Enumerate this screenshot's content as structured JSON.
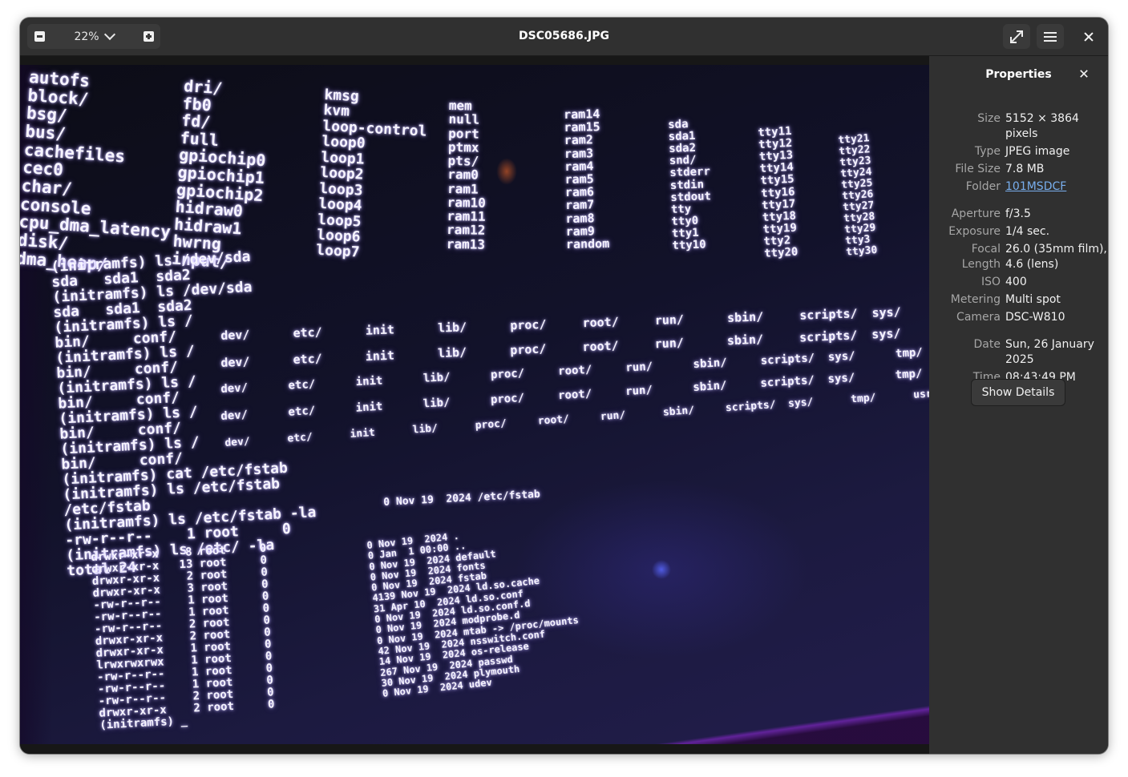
{
  "window": {
    "title": "DSC05686.JPG"
  },
  "toolbar": {
    "zoom_level": "22%",
    "zoom_out_icon": "zoom-out-icon",
    "zoom_in_icon": "zoom-in-icon",
    "fullscreen_icon": "fullscreen-icon",
    "menu_icon": "hamburger-menu-icon",
    "close_icon": "close-icon"
  },
  "sidebar": {
    "title": "Properties",
    "properties": [
      {
        "label": "Size",
        "value": "5152 × 3864 pixels"
      },
      {
        "label": "Type",
        "value": "JPEG image"
      },
      {
        "label": "File Size",
        "value": "7.8 MB"
      },
      {
        "label": "Folder",
        "value": "101MSDCF"
      },
      {
        "label": "Aperture",
        "value": "f/3.5"
      },
      {
        "label": "Exposure",
        "value": "1/4 sec."
      },
      {
        "label": "Focal Length",
        "value": "26.0 (35mm film), 4.6 (lens)"
      },
      {
        "label": "ISO",
        "value": "400"
      },
      {
        "label": "Metering",
        "value": "Multi spot"
      },
      {
        "label": "Camera",
        "value": "DSC-W810"
      },
      {
        "label": "Date",
        "value": "Sun, 26 January 2025"
      },
      {
        "label": "Time",
        "value": "08:43:49 PM"
      }
    ],
    "details_button": "Show Details"
  },
  "photo": {
    "col_a": "autofs\nblock/\nbsg/\nbus/\ncachefiles\ncec0\nchar/\nconsole\ncpu_dma_latency\ndisk/\ndma_heap/",
    "col_b": "dri/\nfb0\nfd/\nfull\ngpiochip0\ngpiochip1\ngpiochip2\nhidraw0\nhidraw1\nhwrng\ninput/",
    "col_c": "kmsg\nkvm\nloop-control\nloop0\nloop1\nloop2\nloop3\nloop4\nloop5\nloop6\nloop7",
    "col_d": "mem\nnull\nport\nptmx\npts/\nram0\nram1\nram10\nram11\nram12\nram13",
    "col_e": "ram14\nram15\nram2\nram3\nram4\nram5\nram6\nram7\nram8\nram9\nrandom",
    "col_f": "sda\nsda1\nsda2\nsnd/\nstderr\nstdin\nstdout\ntty\ntty0\ntty1\ntty10",
    "col_g": "tty11\ntty12\ntty13\ntty14\ntty15\ntty16\ntty17\ntty18\ntty19\ntty2\ntty20",
    "col_h": "tty21\ntty22\ntty23\ntty24\ntty25\ntty26\ntty27\ntty28\ntty29\ntty3\ntty30",
    "session_1": "(initramfs) ls /dev/sda\nsda   sda1  sda2\n(initramfs) ls /dev/sda\nsda   sda1  sda2\n(initramfs) ls /\nbin/     conf/\n(initramfs) ls /\nbin/     conf/\n(initramfs) ls /\nbin/     conf/\n(initramfs) ls /\nbin/     conf/\n(initramfs) ls /\nbin/     conf/\n(initramfs) cat /etc/fstab\n(initramfs) ls /etc/fstab\n/etc/fstab\n(initramfs) ls /etc/fstab -la\n-rw-r--r--    1 root     0\n(initramfs) ls /etc/ -la\ntotal 24",
    "root_row": "dev/      etc/      init      lib/      proc/     root/     run/      sbin/     scripts/  sys/      tmp/      usr/      var/",
    "perm_list": "drwxr-xr-x    8 root     0\ndrwxr-xr-x   13 root     0\ndrwxr-xr-x    2 root     0\ndrwxr-xr-x    3 root     0\n-rw-r--r--    1 root     0\n-rw-r--r--    1 root     0\n-rw-r--r--    2 root     0\ndrwxr-xr-x    2 root     0\ndrwxr-xr-x    1 root     0\nlrwxrwxrwx    1 root     0\n-rw-r--r--    1 root     0\n-rw-r--r--    1 root     0\n-rw-r--r--    2 root     0\ndrwxr-xr-x    2 root     0\n(initramfs) _",
    "fstab_line": "0 Nov 19  2024 /etc/fstab",
    "date_list": "0 Nov 19  2024 .\n0 Jan  1 00:00 ..\n0 Nov 19  2024 default\n0 Nov 19  2024 fonts\n0 Nov 19  2024 fstab\n4139 Nov 19  2024 ld.so.cache\n31 Apr 10  2024 ld.so.conf\n0 Nov 19  2024 ld.so.conf.d\n0 Nov 19  2024 modprobe.d\n0 Nov 19  2024 mtab -> /proc/mounts\n42 Nov 19  2024 nsswitch.conf\n14 Nov 19  2024 os-release\n267 Nov 19  2024 passwd\n30 Nov 19  2024 plymouth\n0 Nov 19  2024 udev"
  }
}
